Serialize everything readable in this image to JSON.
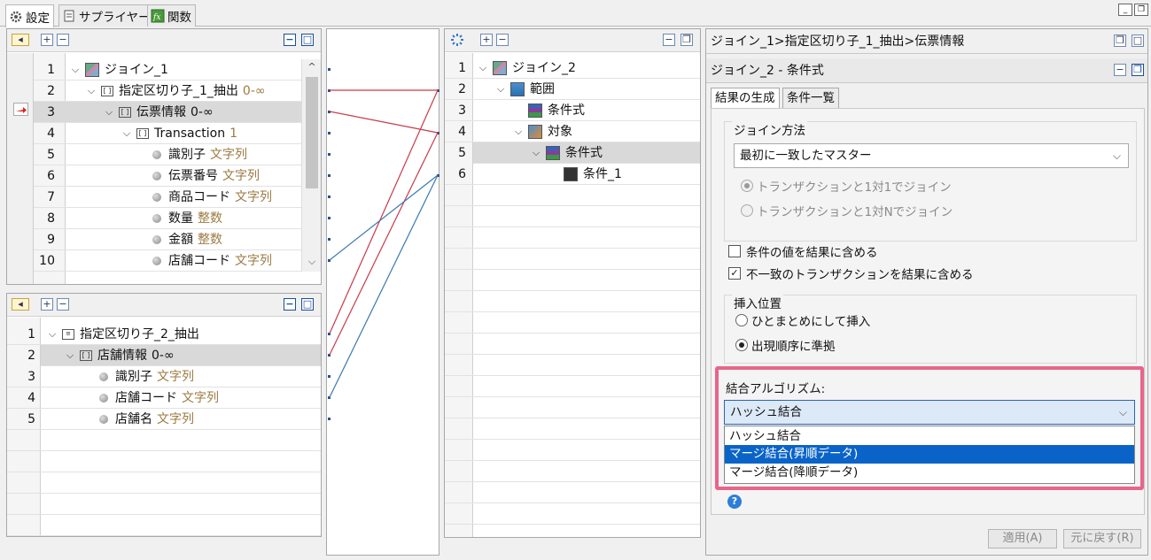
{
  "tabs": [
    {
      "label": "設定",
      "icon": "gear-icon"
    },
    {
      "label": "サプライヤー",
      "icon": "document-icon"
    },
    {
      "label": "関数",
      "icon": "function-icon"
    }
  ],
  "left_top": {
    "rows": [
      {
        "num": "1",
        "label": "ジョイン_1",
        "type": "",
        "kind": "join"
      },
      {
        "num": "2",
        "label": "指定区切り子_1_抽出",
        "type": "0-∞",
        "kind": "bracket"
      },
      {
        "num": "3",
        "label": "伝票情報",
        "type": "0-∞",
        "kind": "bracket"
      },
      {
        "num": "4",
        "label": "Transaction",
        "type": "1",
        "kind": "bracket"
      },
      {
        "num": "5",
        "label": "識別子",
        "type": "文字列",
        "kind": "leaf"
      },
      {
        "num": "6",
        "label": "伝票番号",
        "type": "文字列",
        "kind": "leaf"
      },
      {
        "num": "7",
        "label": "商品コード",
        "type": "文字列",
        "kind": "leaf"
      },
      {
        "num": "8",
        "label": "数量",
        "type": "整数",
        "kind": "leaf"
      },
      {
        "num": "9",
        "label": "金額",
        "type": "整数",
        "kind": "leaf"
      },
      {
        "num": "10",
        "label": "店舗コード",
        "type": "文字列",
        "kind": "leaf"
      }
    ]
  },
  "left_bottom": {
    "rows": [
      {
        "num": "1",
        "label": "指定区切り子_2_抽出",
        "type": ""
      },
      {
        "num": "2",
        "label": "店舗情報",
        "type": "0-∞"
      },
      {
        "num": "3",
        "label": "識別子",
        "type": "文字列"
      },
      {
        "num": "4",
        "label": "店舗コード",
        "type": "文字列"
      },
      {
        "num": "5",
        "label": "店舗名",
        "type": "文字列"
      }
    ]
  },
  "middle_tree": {
    "rows": [
      {
        "num": "1",
        "label": "ジョイン_2"
      },
      {
        "num": "2",
        "label": "範囲"
      },
      {
        "num": "3",
        "label": "条件式"
      },
      {
        "num": "4",
        "label": "対象"
      },
      {
        "num": "5",
        "label": "条件式"
      },
      {
        "num": "6",
        "label": "条件_1"
      }
    ]
  },
  "right": {
    "breadcrumb": "ジョイン_1>指定区切り子_1_抽出>伝票情報",
    "sub_title": "ジョイン_2 - 条件式",
    "tabs": [
      "結果の生成",
      "条件一覧"
    ],
    "join_method_label": "ジョイン方法",
    "join_method_value": "最初に一致したマスター",
    "radio_one_to_one": "トランザクションと1対1でジョイン",
    "radio_one_to_n": "トランザクションと1対Nでジョイン",
    "check_include_condition": "条件の値を結果に含める",
    "check_include_mismatch": "不一致のトランザクションを結果に含める",
    "insert_position_label": "挿入位置",
    "radio_insert_together": "ひとまとめにして挿入",
    "radio_insert_order": "出現順序に準拠",
    "algorithm_label": "結合アルゴリズム:",
    "algorithm_value": "ハッシュ結合",
    "algorithm_options": [
      "ハッシュ結合",
      "マージ結合(昇順データ)",
      "マージ結合(降順データ)"
    ],
    "apply_button": "適用(A)",
    "revert_button": "元に戻す(R)",
    "highlight_color": "#e8658a",
    "selected_option_color": "#0a64c8"
  }
}
